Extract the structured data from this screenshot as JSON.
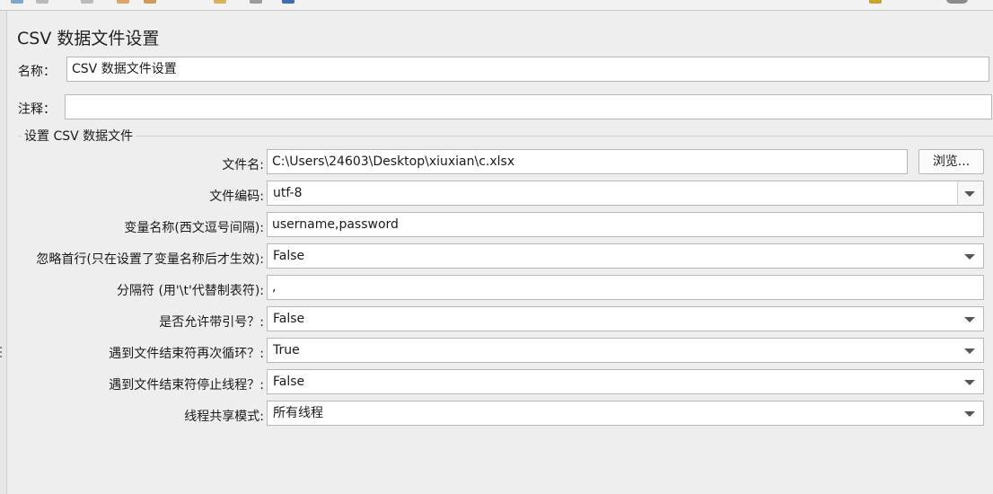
{
  "panel": {
    "title": "CSV 数据文件设置",
    "name_label": "名称：",
    "name_value": "CSV 数据文件设置",
    "comment_label": "注释：",
    "comment_value": "",
    "group_title": "设置 CSV 数据文件"
  },
  "form": {
    "filename": {
      "label": "文件名:",
      "value": "C:\\Users\\24603\\Desktop\\xiuxian\\c.xlsx",
      "browse_label": "浏览..."
    },
    "encoding": {
      "label": "文件编码:",
      "value": "utf-8"
    },
    "var_names": {
      "label": "变量名称(西文逗号间隔):",
      "value": "username,password"
    },
    "ignore_first_line": {
      "label": "忽略首行(只在设置了变量名称后才生效):",
      "value": "False"
    },
    "delimiter": {
      "label": "分隔符 (用'\\t'代替制表符):",
      "value": ","
    },
    "allow_quoted": {
      "label": "是否允许带引号？:",
      "value": "False"
    },
    "recycle_on_eof": {
      "label": "遇到文件结束符再次循环？:",
      "value": "True"
    },
    "stop_thread_on_eof": {
      "label": "遇到文件结束符停止线程？:",
      "value": "False"
    },
    "sharing_mode": {
      "label": "线程共享模式:",
      "value": "所有线程"
    }
  },
  "colors": {
    "background": "#eeeeee",
    "field_bg": "#ffffff",
    "border": "#b8b8b8"
  }
}
